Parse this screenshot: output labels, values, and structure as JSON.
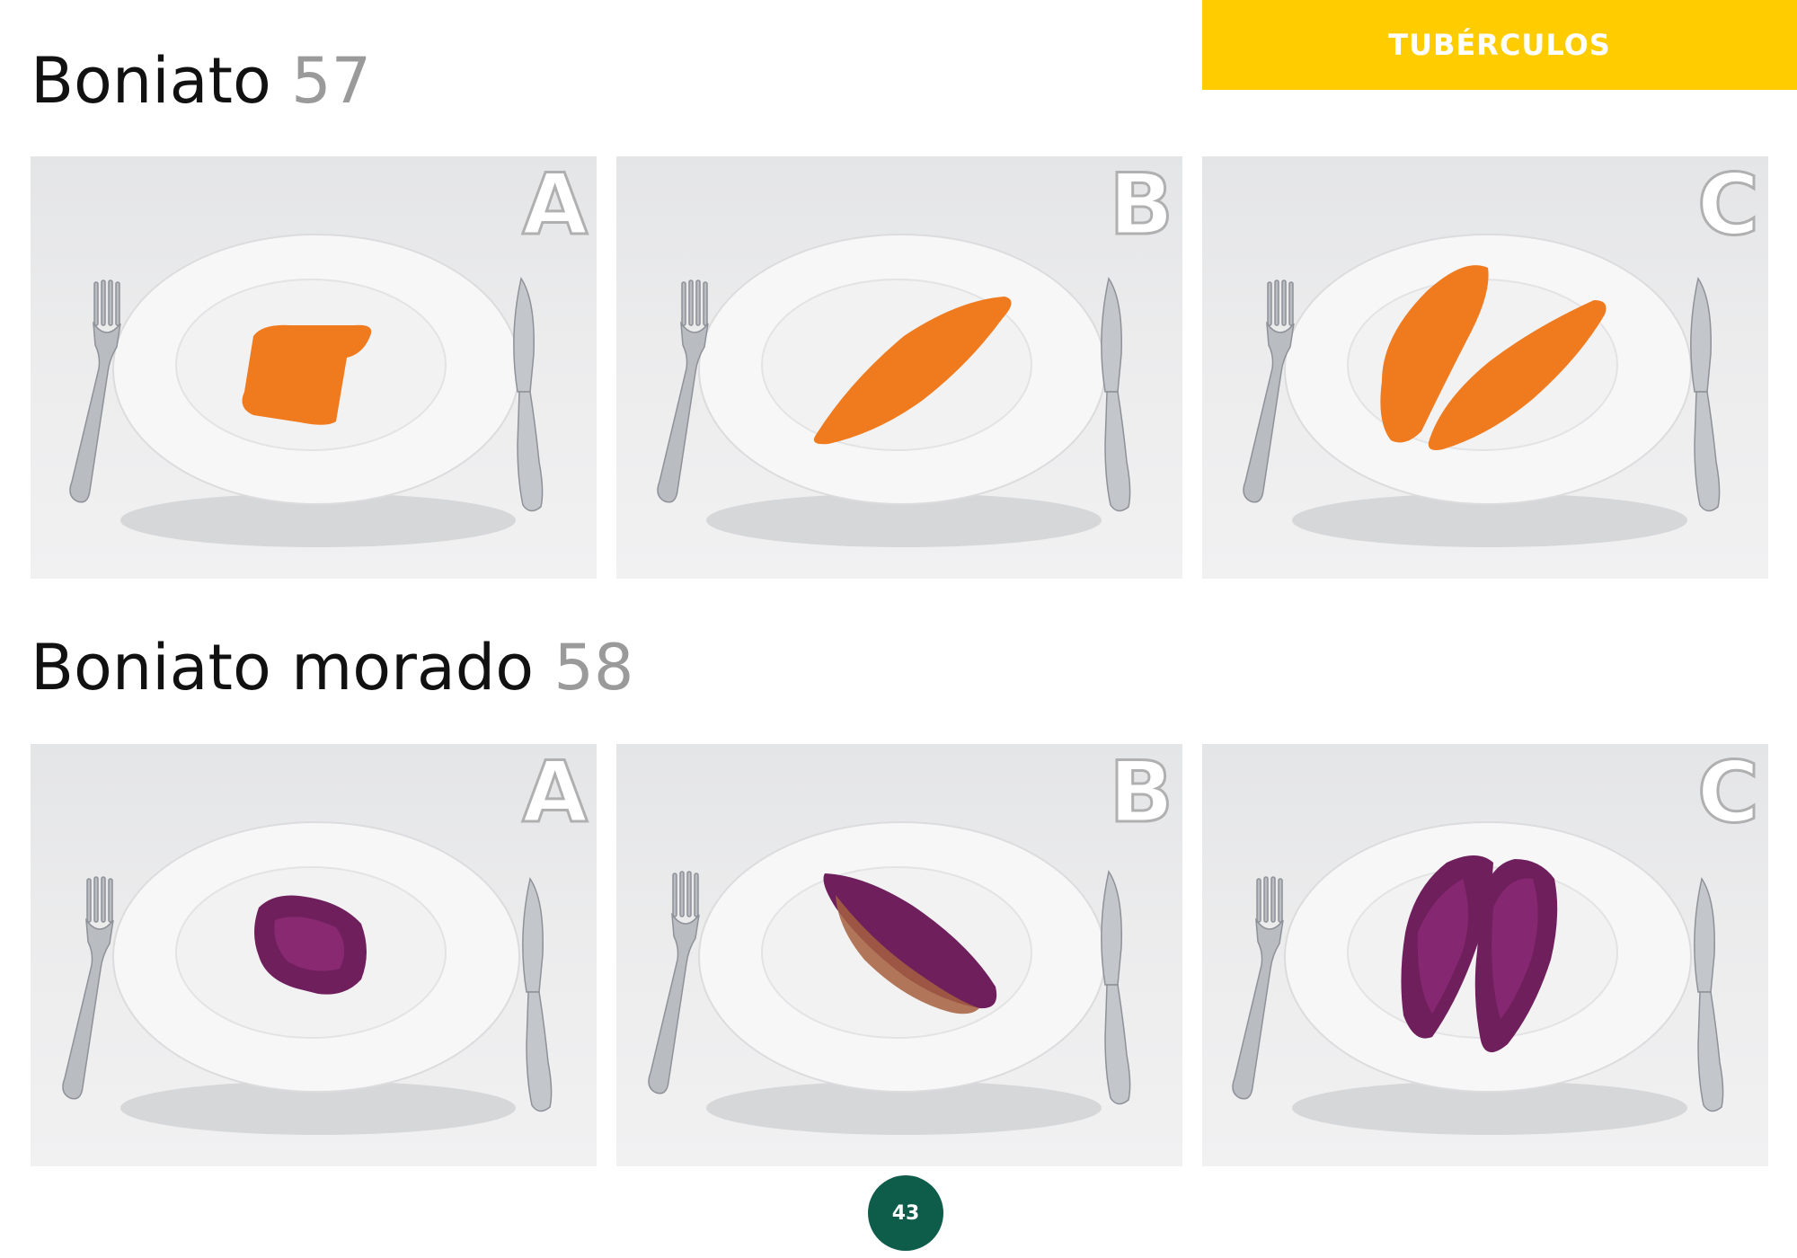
{
  "category": "TUBÉRCULOS",
  "sections": [
    {
      "name": "Boniato",
      "number": "57",
      "portions": [
        {
          "label": "A",
          "food_color": "#f07a1e"
        },
        {
          "label": "B",
          "food_color": "#f07a1e"
        },
        {
          "label": "C",
          "food_color": "#f07a1e"
        }
      ]
    },
    {
      "name": "Boniato morado",
      "number": "58",
      "portions": [
        {
          "label": "A",
          "food_color": "#6e1f5c"
        },
        {
          "label": "B",
          "food_color": "#6e1f5c"
        },
        {
          "label": "C",
          "food_color": "#6e1f5c"
        }
      ]
    }
  ],
  "page_number": "43",
  "colors": {
    "banner": "#ffcc00",
    "page_badge": "#0e5c4a",
    "title_number": "#9a9a9a"
  }
}
